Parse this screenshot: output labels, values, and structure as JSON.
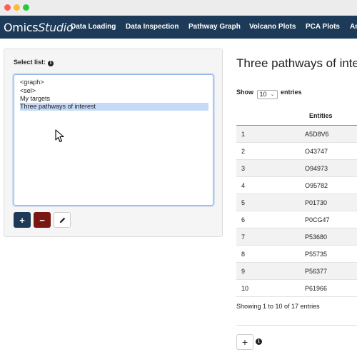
{
  "app": {
    "brand_prefix": "Omics",
    "brand_suffix": "Studio"
  },
  "nav": {
    "items": [
      {
        "label": "Data Loading"
      },
      {
        "label": "Data Inspection"
      },
      {
        "label": "Pathway Graph"
      },
      {
        "label": "Volcano Plots"
      },
      {
        "label": "PCA Plots"
      },
      {
        "label": "An"
      }
    ]
  },
  "left": {
    "select_label": "Select list:",
    "options": [
      "<graph>",
      "<sel>",
      "My targets",
      "Three pathways of interest"
    ],
    "selected_option": "Three pathways of interest",
    "add_label": "+",
    "remove_label": "−",
    "info_glyph": "i"
  },
  "right": {
    "title": "Three pathways of inter",
    "show_label": "Show",
    "show_value": "10",
    "entries_label": "entries",
    "column_header": "Entities",
    "rows": [
      {
        "idx": "1",
        "entity": "A5D8V6"
      },
      {
        "idx": "2",
        "entity": "O43747"
      },
      {
        "idx": "3",
        "entity": "O94973"
      },
      {
        "idx": "4",
        "entity": "O95782"
      },
      {
        "idx": "5",
        "entity": "P01730"
      },
      {
        "idx": "6",
        "entity": "P0CG47"
      },
      {
        "idx": "7",
        "entity": "P53680"
      },
      {
        "idx": "8",
        "entity": "P55735"
      },
      {
        "idx": "9",
        "entity": "P56377"
      },
      {
        "idx": "10",
        "entity": "P61966"
      }
    ],
    "showing_text": "Showing 1 to 10 of 17 entries",
    "add_label": "+"
  },
  "colors": {
    "navbar": "#1d3b58",
    "add_button": "#1d3b58",
    "remove_button": "#7a1712",
    "selection": "#c5daf7"
  },
  "icons": [
    "info-icon",
    "pencil-icon",
    "mouse-cursor-icon"
  ]
}
